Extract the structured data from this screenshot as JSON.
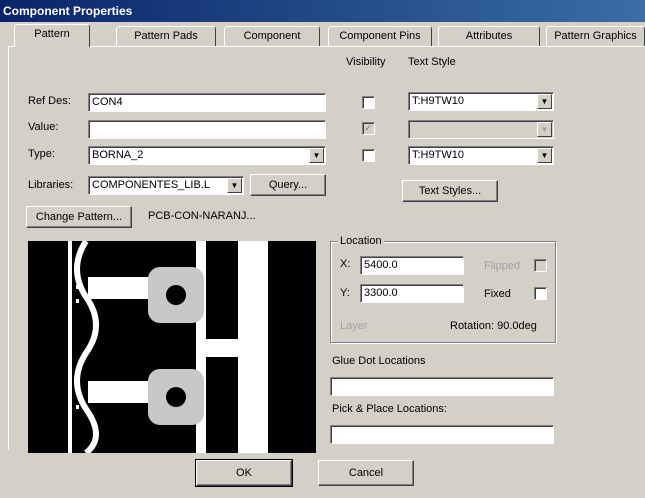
{
  "window": {
    "title": "Component Properties"
  },
  "tabs": [
    {
      "label": "Pattern",
      "active": true
    },
    {
      "label": "Pattern Pads"
    },
    {
      "label": "Component"
    },
    {
      "label": "Component Pins"
    },
    {
      "label": "Attributes"
    },
    {
      "label": "Pattern Graphics"
    }
  ],
  "columns": {
    "visibility": "Visibility",
    "text_style": "Text Style"
  },
  "fields": {
    "ref_des": {
      "label": "Ref Des:",
      "value": "CON4",
      "visible": false,
      "text_style": "T:H9TW10"
    },
    "value": {
      "label": "Value:",
      "value": "",
      "visible": true,
      "text_style": ""
    },
    "type": {
      "label": "Type:",
      "value": "BORNA_2",
      "visible": false,
      "text_style": "T:H9TW10"
    },
    "libraries": {
      "label": "Libraries:",
      "value": "COMPONENTES_LIB.L"
    }
  },
  "buttons": {
    "query": "Query...",
    "text_styles": "Text Styles...",
    "change_pattern": "Change Pattern...",
    "ok": "OK",
    "cancel": "Cancel"
  },
  "pattern_name": "PCB-CON-NARANJ...",
  "location": {
    "title": "Location",
    "x_label": "X:",
    "x_value": "5400.0",
    "y_label": "Y:",
    "y_value": "3300.0",
    "flipped_label": "Flipped",
    "fixed_label": "Fixed",
    "layer_label": "Layer",
    "rotation_label": "Rotation: 90.0deg"
  },
  "glue_dot": {
    "label": "Glue Dot Locations",
    "value": ""
  },
  "pick_place": {
    "label": "Pick & Place Locations:",
    "value": ""
  }
}
